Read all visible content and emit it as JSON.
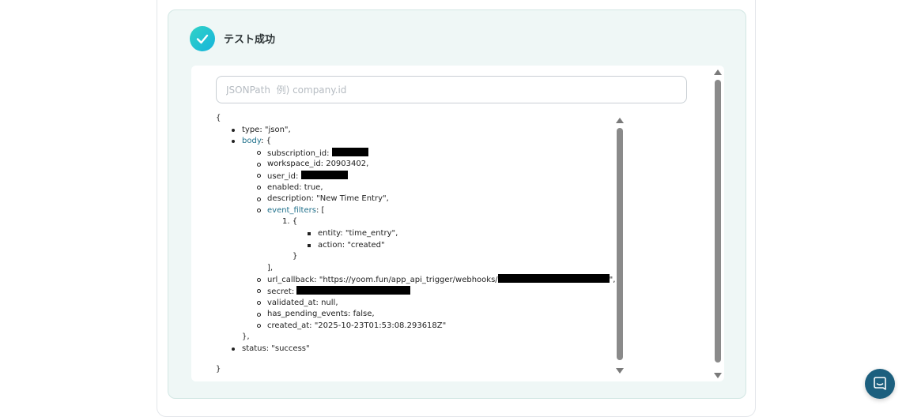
{
  "status": {
    "title": "テスト成功",
    "icon": "check-icon",
    "color": "#1fc1d5"
  },
  "search": {
    "placeholder": "JSONPath  例) company.id",
    "value": ""
  },
  "json": {
    "open_brace": "{",
    "close_brace": "}",
    "type_line": "type: \"json\",",
    "body_key": "body",
    "body_open": ": {",
    "subscription_id_label": "subscription_id: ",
    "workspace_id_line": "workspace_id: 20903402,",
    "user_id_label": "user_id: ",
    "enabled_line": "enabled: true,",
    "description_line": "description: \"New Time Entry\",",
    "event_filters_key": "event_filters",
    "event_filters_open": ": [",
    "filter_item_marker": "1.",
    "filter_item_open": "{",
    "entity_line": "entity: \"time_entry\",",
    "action_line": "action: \"created\"",
    "filter_item_close": "}",
    "event_filters_close": "],",
    "url_callback_label": "url_callback: \"https://yoom.fun/app_api_trigger/webhooks/",
    "url_callback_tail": "\",",
    "secret_label": "secret: ",
    "validated_at_line": "validated_at: null,",
    "has_pending_events_line": "has_pending_events: false,",
    "created_at_line": "created_at: \"2025-10-23T01:53:08.293618Z\"",
    "body_close": "},",
    "status_line": "status: \"success\""
  },
  "chat": {
    "icon": "chat-bubble-icon"
  }
}
